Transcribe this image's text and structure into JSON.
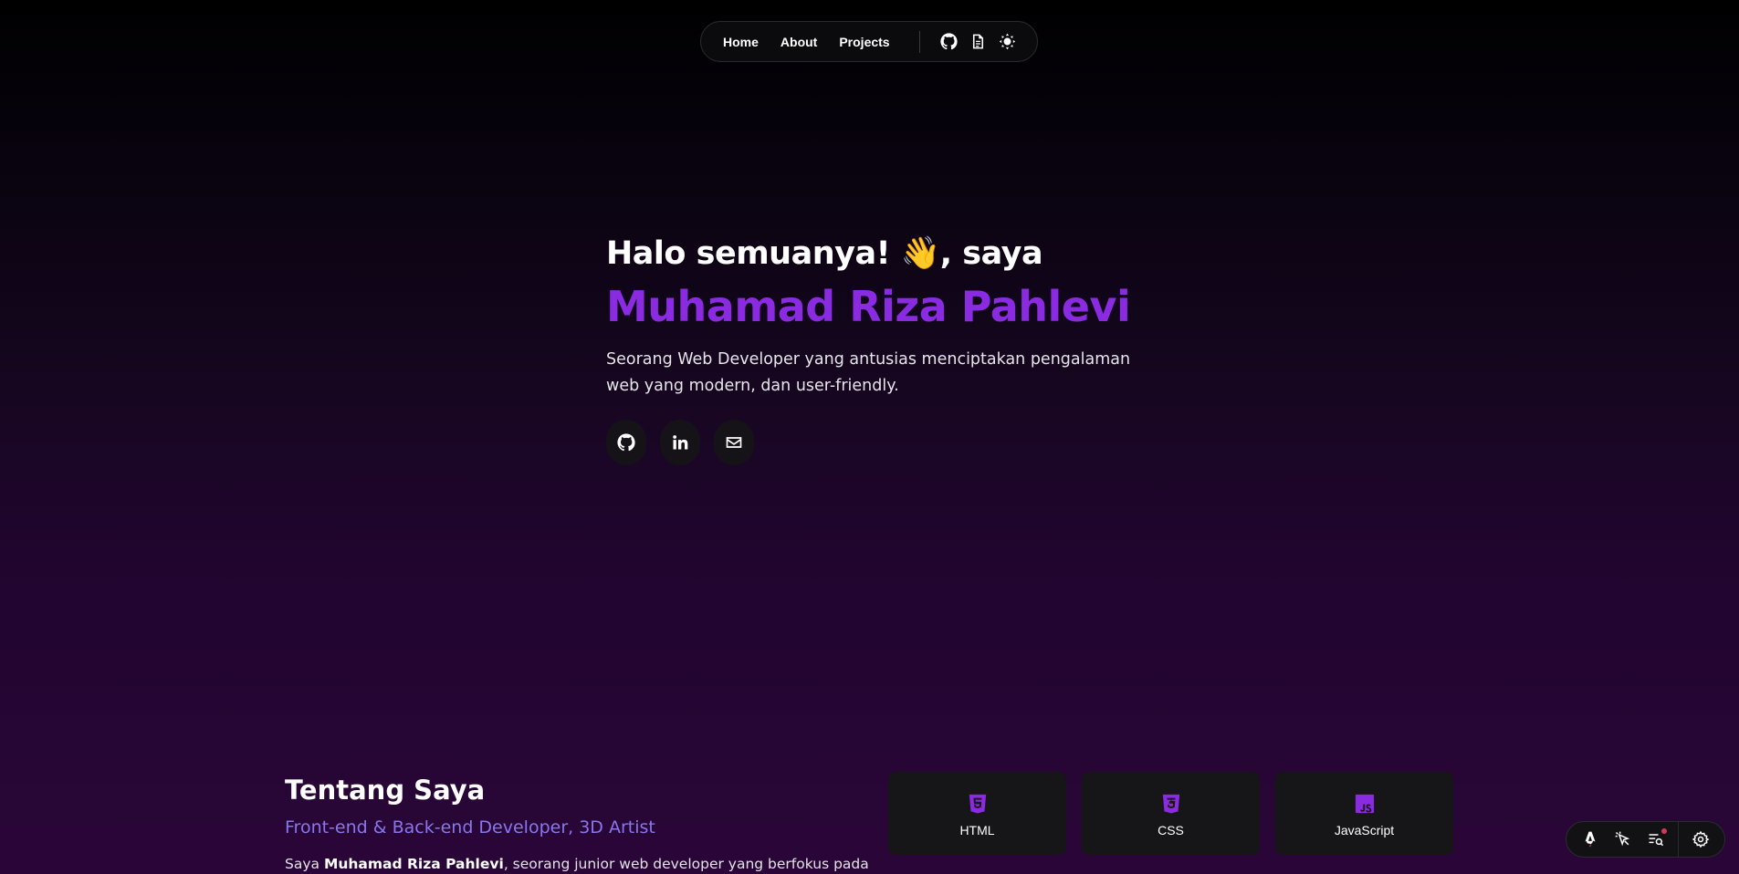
{
  "nav": {
    "links": [
      "Home",
      "About",
      "Projects"
    ],
    "icons": [
      "github-icon",
      "document-icon",
      "theme-toggle-icon"
    ]
  },
  "hero": {
    "greeting": "Halo semuanya! 👋, saya",
    "name": "Muhamad Riza Pahlevi",
    "description": "Seorang Web Developer yang antusias menciptakan pengalaman web yang modern, dan user-friendly.",
    "socials": [
      "github-icon",
      "linkedin-icon",
      "mail-icon"
    ]
  },
  "about": {
    "title": "Tentang Saya",
    "role": "Front-end & Back-end Developer, 3D Artist",
    "text_prefix": "Saya ",
    "text_name": "Muhamad Riza Pahlevi",
    "text_suffix": ", seorang junior web developer yang berfokus pada"
  },
  "skills": [
    {
      "label": "HTML",
      "icon": "html5-icon"
    },
    {
      "label": "CSS",
      "icon": "css3-icon"
    },
    {
      "label": "JavaScript",
      "icon": "javascript-icon"
    }
  ],
  "colors": {
    "accent": "#8a2be2",
    "role": "#8877ee",
    "card": "#161518"
  },
  "toolbar": {
    "icons": [
      "astro-icon",
      "cursor-inspect-icon",
      "audit-list-icon",
      "settings-gear-icon"
    ]
  }
}
